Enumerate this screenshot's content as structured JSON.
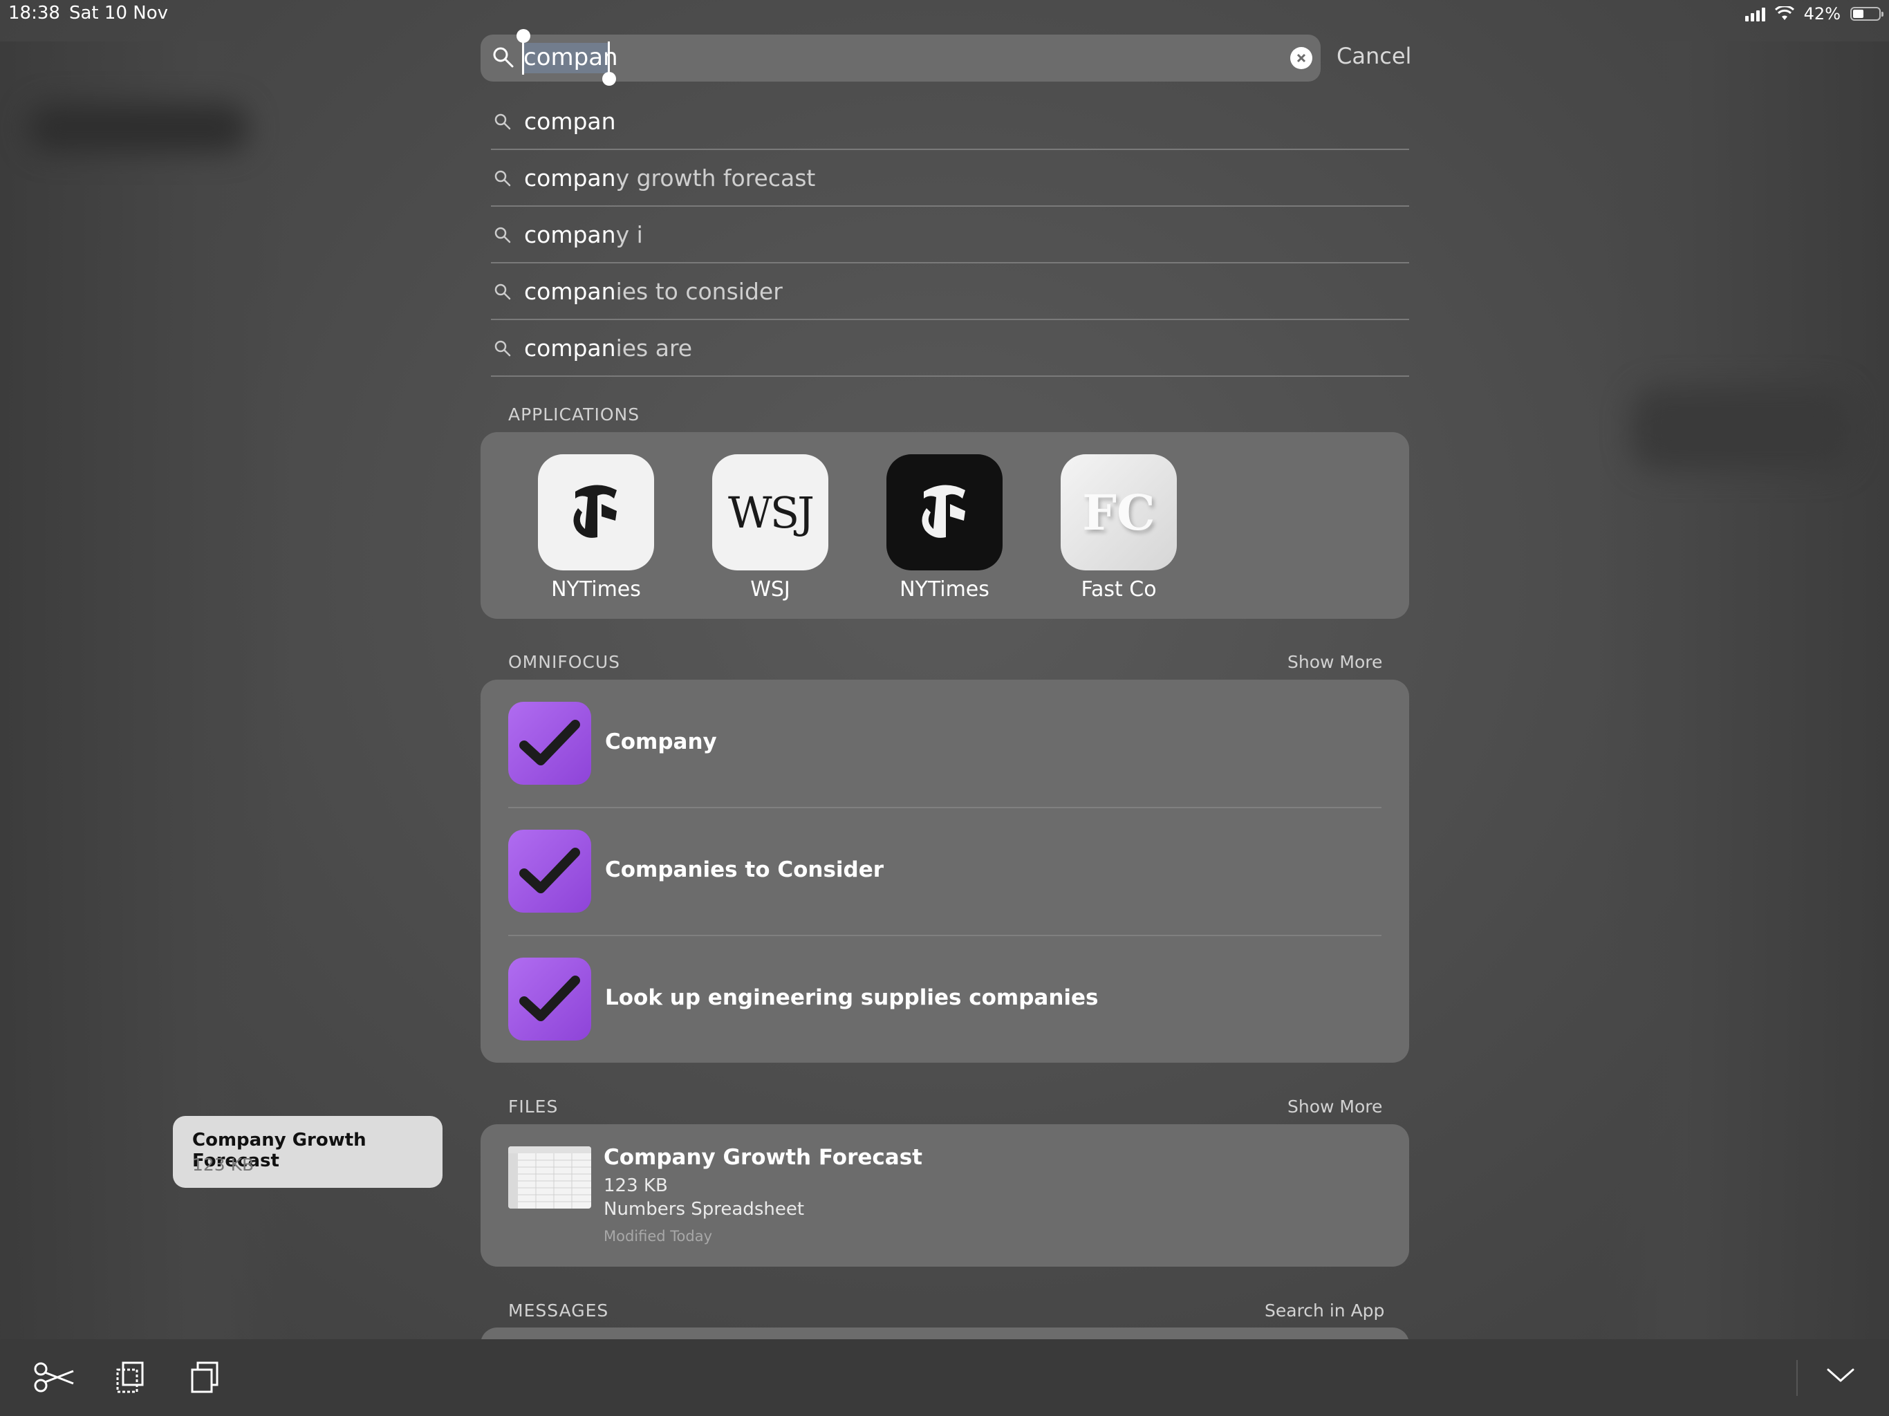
{
  "status_bar": {
    "time": "18:38",
    "date": "Sat 10 Nov",
    "battery_percent": "42%",
    "battery_level": 0.42
  },
  "search": {
    "query": "compan",
    "cancel_label": "Cancel"
  },
  "suggestions": [
    {
      "match": "compan",
      "rest": ""
    },
    {
      "match": "compan",
      "rest": "y growth forecast"
    },
    {
      "match": "compan",
      "rest": "y i"
    },
    {
      "match": "compan",
      "rest": "ies to consider"
    },
    {
      "match": "compan",
      "rest": "ies are"
    }
  ],
  "applications": {
    "title": "APPLICATIONS",
    "apps": [
      {
        "label": "NYTimes",
        "icon": "nytimes-icon"
      },
      {
        "label": "WSJ",
        "icon": "wsj-icon",
        "glyph": "WSJ"
      },
      {
        "label": "NYTimes",
        "icon": "nytimes-dark-icon"
      },
      {
        "label": "Fast Co",
        "icon": "fastco-icon",
        "glyph": "FC"
      }
    ]
  },
  "omnifocus": {
    "title": "OMNIFOCUS",
    "show_more": "Show More",
    "items": [
      {
        "label": "Company"
      },
      {
        "label": "Companies to Consider"
      },
      {
        "label": "Look up engineering supplies companies"
      }
    ]
  },
  "files": {
    "title": "FILES",
    "show_more": "Show More",
    "item": {
      "title": "Company Growth Forecast",
      "size": "123 KB",
      "kind": "Numbers Spreadsheet",
      "modified": "Modified Today"
    }
  },
  "messages": {
    "title": "MESSAGES",
    "link": "Search in App"
  },
  "tooltip": {
    "title": "Company Growth Forecast",
    "subtitle": "123 KB"
  },
  "colors": {
    "omnifocus_purple": "#9b55e3",
    "card": "#6c6c6c"
  }
}
